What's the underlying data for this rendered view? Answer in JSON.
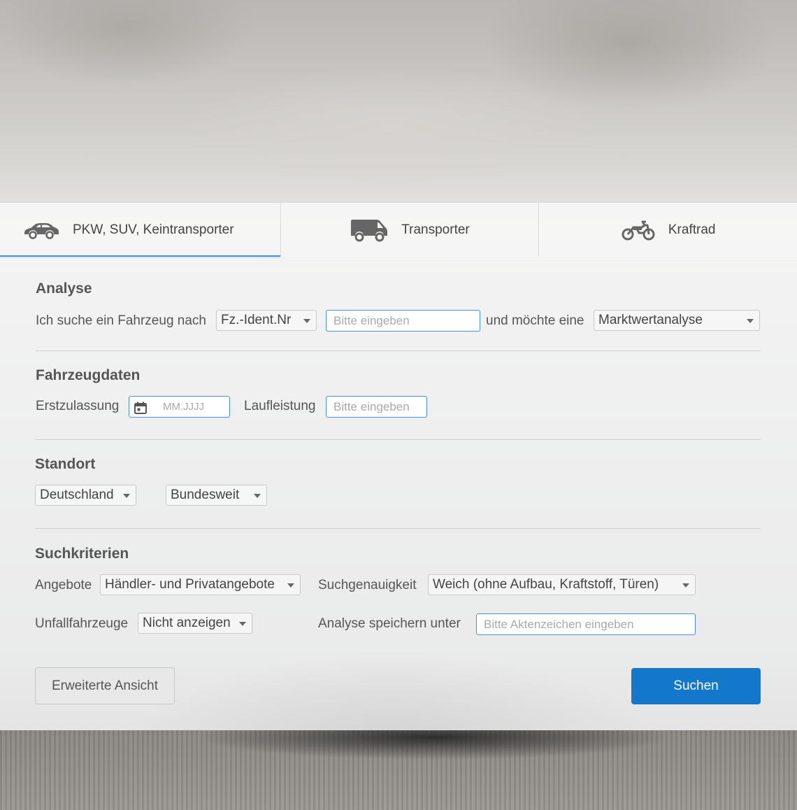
{
  "tabs": [
    {
      "label": "PKW, SUV, Keintransporter",
      "icon": "car-icon",
      "active": true
    },
    {
      "label": "Transporter",
      "icon": "van-icon",
      "active": false
    },
    {
      "label": "Kraftrad",
      "icon": "motorcycle-icon",
      "active": false
    }
  ],
  "analyse": {
    "title": "Analyse",
    "prefix_label": "Ich suche ein Fahrzeug nach",
    "search_type": "Fz.-Ident.Nr",
    "search_placeholder": "Bitte eingeben",
    "middle_label": "und möchte eine",
    "analysis_type": "Marktwertanalyse"
  },
  "fahrzeugdaten": {
    "title": "Fahrzeugdaten",
    "erstzulassung_label": "Erstzulassung",
    "erstzulassung_placeholder": "MM.JJJJ",
    "laufleistung_label": "Laufleistung",
    "laufleistung_placeholder": "Bitte eingeben"
  },
  "standort": {
    "title": "Standort",
    "country": "Deutschland",
    "region": "Bundesweit"
  },
  "suchkriterien": {
    "title": "Suchkriterien",
    "angebote_label": "Angebote",
    "angebote_value": "Händler- und Privatangebote",
    "suchgenauigkeit_label": "Suchgenauigkeit",
    "suchgenauigkeit_value": "Weich (ohne Aufbau, Kraftstoff, Türen)",
    "unfall_label": "Unfallfahrzeuge",
    "unfall_value": "Nicht anzeigen",
    "speichern_label": "Analyse speichern unter",
    "speichern_placeholder": "Bitte Aktenzeichen eingeben"
  },
  "buttons": {
    "advanced": "Erweiterte Ansicht",
    "search": "Suchen"
  },
  "colors": {
    "accent": "#4a90d9",
    "primary_button": "#1378c9"
  }
}
